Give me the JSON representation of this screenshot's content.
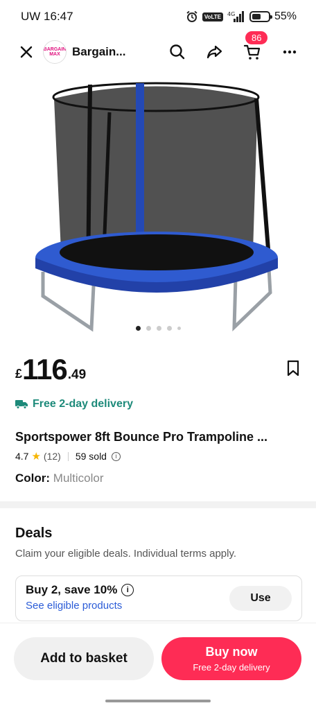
{
  "status_bar": {
    "carrier_time": "UW 16:47",
    "network": "4G",
    "volte": "VoLTE",
    "battery_level": 0.55,
    "battery_text": "55%"
  },
  "header": {
    "store_name": "Bargain...",
    "logo_text": "BARGAIN MAX",
    "cart_count": "86"
  },
  "gallery": {
    "image_subject": "trampoline-with-net",
    "total_images": 5,
    "current_index": 1
  },
  "product": {
    "currency": "£",
    "price_whole": "116",
    "price_decimal": ".49",
    "delivery": "Free 2-day delivery",
    "title": "Sportspower 8ft Bounce Pro Trampoline ...",
    "rating": "4.7",
    "reviews": "(12)",
    "sold": "59 sold",
    "color_label": "Color:",
    "color_value": "Multicolor"
  },
  "deals": {
    "title": "Deals",
    "subtitle": "Claim your eligible deals. Individual terms apply.",
    "card_title": "Buy 2, save 10%",
    "card_link": "See eligible products",
    "use_label": "Use"
  },
  "actions": {
    "add_to_basket": "Add to basket",
    "buy_now": "Buy now",
    "buy_now_sub": "Free 2-day delivery"
  },
  "colors": {
    "accent": "#fe2c55",
    "delivery": "#1d8a7a",
    "link": "#2a5bd7",
    "star": "#f6b500"
  }
}
